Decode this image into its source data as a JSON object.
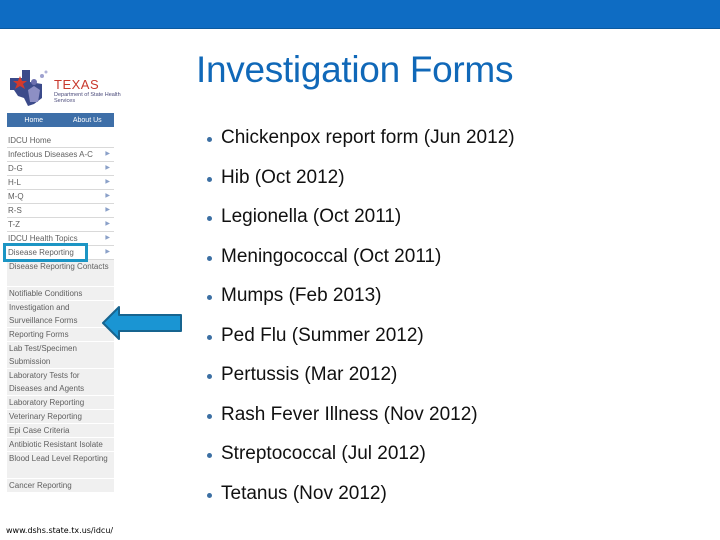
{
  "slide": {
    "title": "Investigation Forms",
    "accent_color": "#0e6cc3",
    "items": [
      "Chickenpox report form (Jun 2012)",
      "Hib (Oct 2012)",
      "Legionella (Oct 2011)",
      "Meningococcal (Oct 2011)",
      "Mumps (Feb 2013)",
      "Ped Flu (Summer 2012)",
      "Pertussis (Mar 2012)",
      "Rash Fever Illness (Nov 2012)",
      "Streptococcal (Jul 2012)",
      "Tetanus (Nov 2012)"
    ]
  },
  "website": {
    "logo": {
      "name": "TEXAS",
      "subtitle": "Department of State Health Services"
    },
    "navbar": [
      "Home",
      "About Us"
    ],
    "menu": [
      {
        "label": "IDCU Home"
      },
      {
        "label": "Infectious Diseases A-C"
      },
      {
        "label": "D-G"
      },
      {
        "label": "H-L"
      },
      {
        "label": "M-Q"
      },
      {
        "label": "R-S"
      },
      {
        "label": "T-Z"
      },
      {
        "label": "IDCU Health Topics"
      },
      {
        "label": "Disease Reporting"
      }
    ],
    "submenu": [
      "Disease Reporting Contacts",
      "Notifiable Conditions",
      "Investigation and Surveillance Forms",
      "Reporting Forms",
      "Lab Test/Specimen Submission",
      "Laboratory Tests for Diseases and Agents",
      "Laboratory Reporting",
      "Veterinary Reporting",
      "Epi Case Criteria",
      "Antibiotic Resistant Isolate",
      "Blood Lead Level Reporting",
      "Cancer Reporting"
    ],
    "url": "www.dshs.state.tx.us/idcu/"
  },
  "icons": {
    "menu_chevron": "arrow-right-icon",
    "pointer": "left-arrow-icon"
  }
}
